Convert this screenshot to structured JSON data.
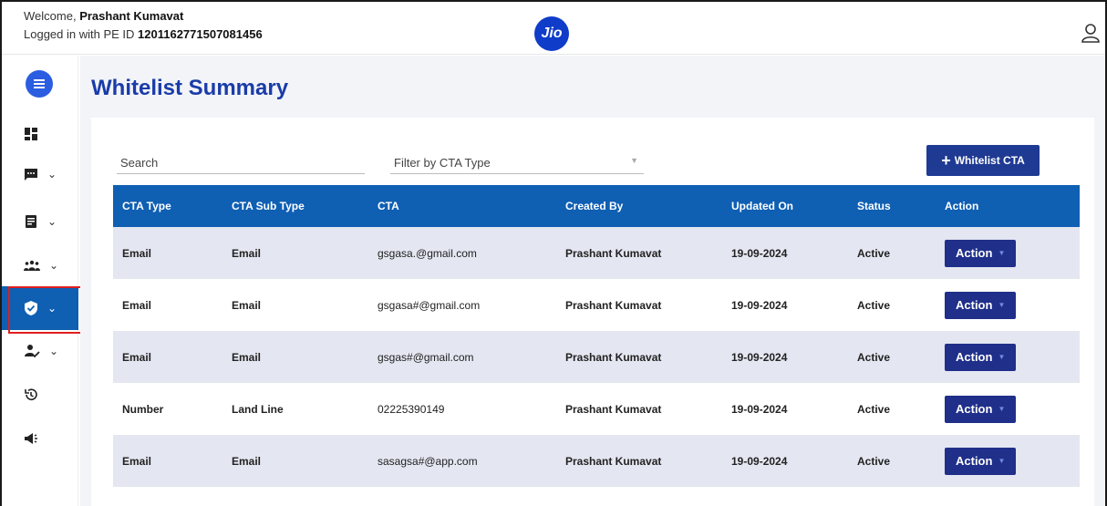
{
  "header": {
    "welcome_prefix": "Welcome,",
    "user_name": "Prashant Kumavat",
    "login_prefix": "Logged in with PE ID",
    "pe_id": "1201162771507081456",
    "logo_text": "Jio"
  },
  "sidebar": {
    "items": [
      {
        "icon": "dashboard-icon"
      },
      {
        "icon": "message-icon",
        "expandable": true
      },
      {
        "icon": "document-icon",
        "expandable": true
      },
      {
        "icon": "group-icon",
        "expandable": true
      },
      {
        "icon": "shield-check-icon",
        "expandable": true,
        "active": true
      },
      {
        "icon": "user-check-icon",
        "expandable": true
      },
      {
        "icon": "history-icon"
      },
      {
        "icon": "megaphone-icon"
      }
    ]
  },
  "page": {
    "title": "Whitelist Summary"
  },
  "toolbar": {
    "search_placeholder": "Search",
    "filter_placeholder": "Filter by CTA Type",
    "add_button_label": "Whitelist CTA"
  },
  "table": {
    "columns": [
      "CTA Type",
      "CTA Sub Type",
      "CTA",
      "Created By",
      "Updated On",
      "Status",
      "Action"
    ],
    "rows": [
      {
        "type": "Email",
        "subtype": "Email",
        "cta": "gsgasa.@gmail.com",
        "created_by": "Prashant Kumavat",
        "updated_on": "19-09-2024",
        "status": "Active",
        "action": "Action"
      },
      {
        "type": "Email",
        "subtype": "Email",
        "cta": "gsgasa#@gmail.com",
        "created_by": "Prashant Kumavat",
        "updated_on": "19-09-2024",
        "status": "Active",
        "action": "Action"
      },
      {
        "type": "Email",
        "subtype": "Email",
        "cta": "gsgas#@gmail.com",
        "created_by": "Prashant Kumavat",
        "updated_on": "19-09-2024",
        "status": "Active",
        "action": "Action"
      },
      {
        "type": "Number",
        "subtype": "Land Line",
        "cta": "02225390149",
        "created_by": "Prashant Kumavat",
        "updated_on": "19-09-2024",
        "status": "Active",
        "action": "Action"
      },
      {
        "type": "Email",
        "subtype": "Email",
        "cta": "sasagsa#@app.com",
        "created_by": "Prashant Kumavat",
        "updated_on": "19-09-2024",
        "status": "Active",
        "action": "Action"
      }
    ]
  },
  "colors": {
    "primary": "#0f5fb3",
    "button": "#1f3a93",
    "title": "#1a3ca8",
    "highlight": "#e01e1e"
  }
}
